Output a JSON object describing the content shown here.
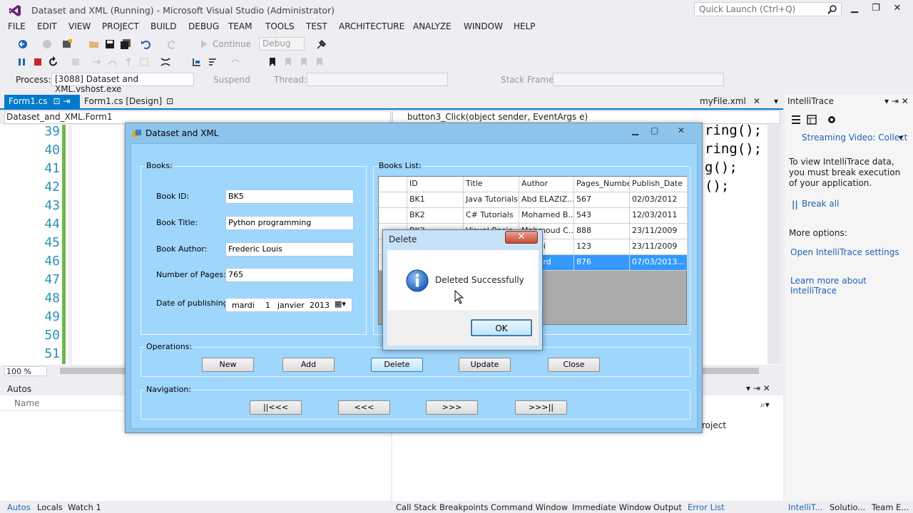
{
  "window": {
    "title": "Dataset and XML (Running) - Microsoft Visual Studio (Administrator)",
    "quick_launch_placeholder": "Quick Launch (Ctrl+Q)"
  },
  "menu": [
    "FILE",
    "EDIT",
    "VIEW",
    "PROJECT",
    "BUILD",
    "DEBUG",
    "TEAM",
    "TOOLS",
    "TEST",
    "ARCHITECTURE",
    "ANALYZE",
    "WINDOW",
    "HELP"
  ],
  "toolbar": {
    "continue_label": "Continue",
    "config_value": "Debug",
    "process_label": "Process:",
    "process_value": "[3088] Dataset and XML.vshost.exe",
    "suspend_label": "Suspend",
    "thread_label": "Thread:",
    "stack_frame_label": "Stack Frame:"
  },
  "doc_tabs": {
    "active": "Form1.cs",
    "design": "Form1.cs [Design]",
    "right": "myFile.xml"
  },
  "nav_bar": {
    "class": "Dataset_and_XML.Form1",
    "member": "button3_Click(object sender, EventArgs e)"
  },
  "editor": {
    "line_numbers": [
      "39",
      "40",
      "41",
      "42",
      "43",
      "44",
      "45",
      "46",
      "47",
      "48",
      "49",
      "50",
      "51"
    ],
    "code_fragments": [
      "ring();",
      "ring();",
      "g();",
      "();"
    ],
    "zoom": "100 %"
  },
  "intellitrace": {
    "title": "IntelliTrace",
    "streaming": "Streaming Video: Collect",
    "message": "To view IntelliTrace data, you must break execution of your application.",
    "break_all": "Break all",
    "more_options": "More options:",
    "open_settings": "Open IntelliTrace settings",
    "learn_more": "Learn more about IntelliTrace"
  },
  "bottom_panel": {
    "autos_title": "Autos",
    "name_col": "Name",
    "project_text": "roject"
  },
  "status_tabs": [
    "Autos",
    "Locals",
    "Watch 1",
    "Call Stack",
    "Breakpoints",
    "Command Window",
    "Immediate Window",
    "Output",
    "Error List",
    "IntelliT...",
    "Solutio...",
    "Team E..."
  ],
  "form": {
    "title": "Dataset and XML",
    "books_group": "Books:",
    "book_id_label": "Book ID:",
    "book_id_value": "BK5",
    "book_title_label": "Book Title:",
    "book_title_value": "Python programming",
    "book_author_label": "Book Author:",
    "book_author_value": "Frederic Louis",
    "pages_label": "Number of Pages:",
    "pages_value": "765",
    "date_label": "Date of publishing",
    "date_day": "mardi",
    "date_num": "1",
    "date_month": "janvier",
    "date_year": "2013",
    "list_group": "Books List:",
    "columns": [
      "ID",
      "Title",
      "Author",
      "Pages_Number",
      "Publish_Date"
    ],
    "rows": [
      [
        "BK1",
        "Java Tutorials",
        "Abd ELAZIZ...",
        "567",
        "02/03/2012"
      ],
      [
        "BK2",
        "C# Tutorials",
        "Mohamed B...",
        "543",
        "12/03/2011"
      ],
      [
        "BK3",
        "Visual Basic",
        "Mahmoud C...",
        "888",
        "23/11/2009"
      ],
      [
        "BK4",
        "",
        "Wahbi",
        "123",
        "23/11/2009"
      ],
      [
        "",
        "",
        "Richard",
        "876",
        "07/03/2013..."
      ]
    ],
    "operations_group": "Operations:",
    "btn_new": "New",
    "btn_add": "Add",
    "btn_delete": "Delete",
    "btn_update": "Update",
    "btn_close": "Close",
    "navigation_group": "Navigation:",
    "nav_first": "||<<<",
    "nav_prev": "<<<",
    "nav_next": ">>>",
    "nav_last": ">>>||"
  },
  "dialog": {
    "title": "Delete",
    "message": "Deleted Successfully",
    "ok": "OK",
    "icon": "info-icon"
  },
  "colors": {
    "vs_accent": "#007acc",
    "form_bg": "#9fd6fc",
    "selection": "#3399ff",
    "line_number": "#2b91af"
  }
}
